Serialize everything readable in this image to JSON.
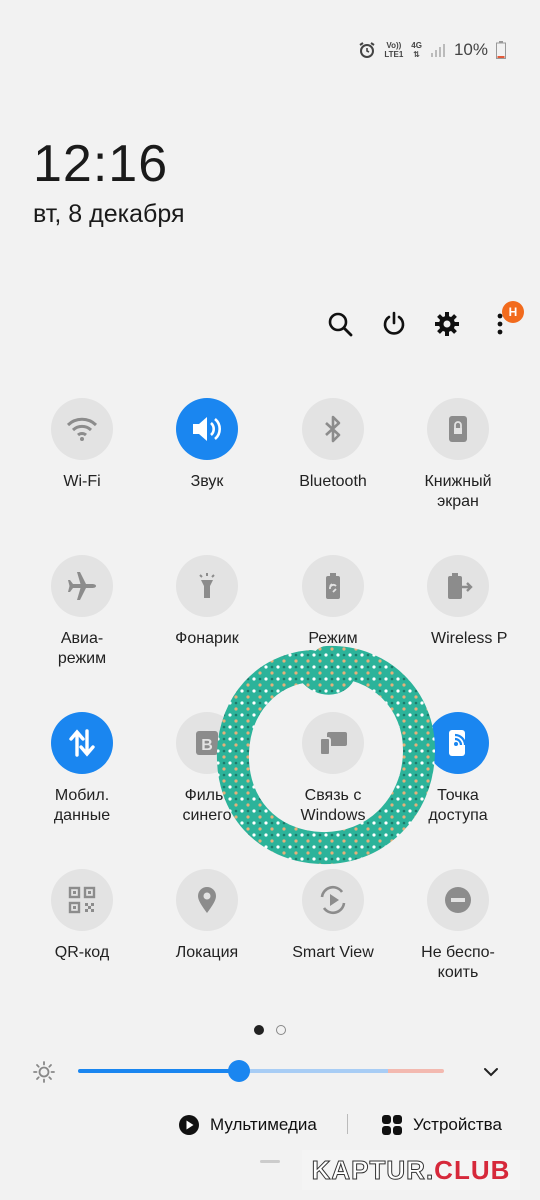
{
  "status": {
    "volte_top": "Vo))",
    "volte_bottom": "LTE1",
    "net_top": "4G",
    "battery": "10%"
  },
  "clock": {
    "time": "12:16",
    "date": "вт, 8 декабря"
  },
  "menu_badge": "H",
  "tiles": [
    {
      "label": "Wi-Fi",
      "icon": "wifi-icon",
      "active": false
    },
    {
      "label": "Звук",
      "icon": "sound-icon",
      "active": true
    },
    {
      "label": "Bluetooth",
      "icon": "bluetooth-icon",
      "active": false
    },
    {
      "label": "Книжный\nэкран",
      "icon": "portrait-lock-icon",
      "active": false
    },
    {
      "label": "Авиа-\nрежим",
      "icon": "airplane-icon",
      "active": false
    },
    {
      "label": "Фонарик",
      "icon": "flashlight-icon",
      "active": false
    },
    {
      "label": "Режим",
      "icon": "battery-saver-icon",
      "active": false
    },
    {
      "label": "Wireless P",
      "icon": "wireless-powershare-icon",
      "active": false
    },
    {
      "label": "Мобил.\nданные",
      "icon": "mobile-data-icon",
      "active": true
    },
    {
      "label": "Фильт\nсинего",
      "icon": "blue-light-filter-icon",
      "active": false
    },
    {
      "label": "Связь с\nWindows",
      "icon": "link-to-windows-icon",
      "active": false
    },
    {
      "label": "Точка\nдоступа",
      "icon": "hotspot-icon",
      "active": true
    },
    {
      "label": "QR-код",
      "icon": "qr-code-icon",
      "active": false
    },
    {
      "label": "Локация",
      "icon": "location-icon",
      "active": false
    },
    {
      "label": "Smart View",
      "icon": "smart-view-icon",
      "active": false
    },
    {
      "label": "Не беспо-\nкоить",
      "icon": "do-not-disturb-icon",
      "active": false
    }
  ],
  "pager": {
    "pages": 2,
    "current": 1
  },
  "brightness": {
    "level_percent": 45
  },
  "bottom": {
    "media": "Мультимедиа",
    "devices": "Устройства"
  },
  "watermark": {
    "part1": "KAPTUR.",
    "part2": "CLUB"
  },
  "colors": {
    "accent": "#1a86f0",
    "tile_off": "#e3e3e3",
    "badge": "#f26b1d",
    "marker": "#2cb39a"
  }
}
